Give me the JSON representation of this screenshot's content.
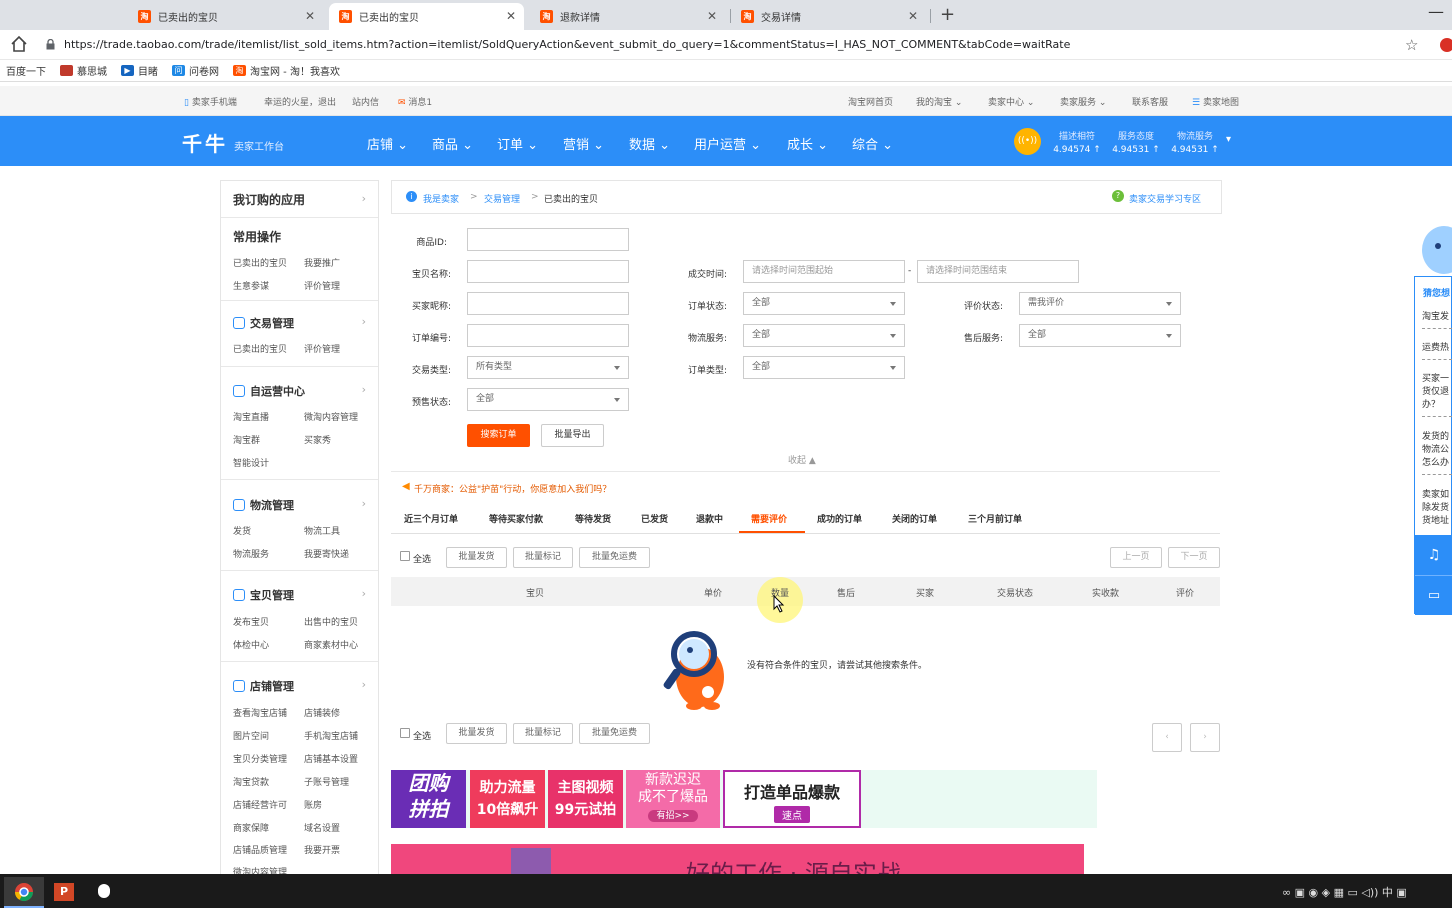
{
  "browser": {
    "tabs": [
      {
        "title": "已卖出的宝贝",
        "active": false
      },
      {
        "title": "已卖出的宝贝",
        "active": true
      },
      {
        "title": "退款详情",
        "active": false
      },
      {
        "title": "交易详情",
        "active": false
      }
    ],
    "favicon_text": "淘",
    "new_tab": "+",
    "minimize": "—",
    "url": "https://trade.taobao.com/trade/itemlist/list_sold_items.htm?action=itemlist/SoldQueryAction&event_submit_do_query=1&commentStatus=I_HAS_NOT_COMMENT&tabCode=waitRate",
    "bookmarks": [
      {
        "label": "百度一下",
        "color": ""
      },
      {
        "label": "慕思城",
        "color": "#c0392b"
      },
      {
        "label": "目睹",
        "color": "#1565c0"
      },
      {
        "label": "问卷网",
        "color": "#1e88e5"
      },
      {
        "label": "淘宝网 - 淘！我喜欢",
        "color": "#ff5000"
      }
    ]
  },
  "sitebar": {
    "mobile": "卖家手机端",
    "user": "幸运的火星，退出",
    "inbox": "站内信",
    "messages": "消息1",
    "home": "淘宝网首页",
    "my_taobao": "我的淘宝",
    "seller_center": "卖家中心",
    "seller_service": "卖家服务",
    "contact": "联系客服",
    "sitemap": "卖家地图"
  },
  "header": {
    "logo": "千牛",
    "logo_sub": "卖家工作台",
    "nav": [
      "店铺",
      "商品",
      "订单",
      "营销",
      "数据",
      "用户运营",
      "成长",
      "综合"
    ],
    "scores": [
      {
        "label": "描述相符",
        "value": "4.94574 ↑"
      },
      {
        "label": "服务态度",
        "value": "4.94531 ↑"
      },
      {
        "label": "物流服务",
        "value": "4.94531 ↑"
      }
    ]
  },
  "sidebar": {
    "my_apps": "我订购的应用",
    "common_title": "常用操作",
    "common": [
      "已卖出的宝贝",
      "我要推广",
      "生意参谋",
      "评价管理"
    ],
    "sections": [
      {
        "title": "交易管理",
        "links": [
          "已卖出的宝贝",
          "评价管理"
        ]
      },
      {
        "title": "自运营中心",
        "links": [
          "淘宝直播",
          "微淘内容管理",
          "淘宝群",
          "买家秀",
          "智能设计"
        ]
      },
      {
        "title": "物流管理",
        "links": [
          "发货",
          "物流工具",
          "物流服务",
          "我要寄快递"
        ]
      },
      {
        "title": "宝贝管理",
        "links": [
          "发布宝贝",
          "出售中的宝贝",
          "体检中心",
          "商家素材中心"
        ]
      },
      {
        "title": "店铺管理",
        "links": [
          "查看淘宝店铺",
          "店铺装修",
          "图片空间",
          "手机淘宝店铺",
          "宝贝分类管理",
          "店铺基本设置",
          "淘宝贷款",
          "子账号管理",
          "店铺经营许可",
          "账房",
          "商家保障",
          "域名设置",
          "店铺品质管理",
          "我要开票",
          "微淘内容管理"
        ]
      }
    ]
  },
  "breadcrumb": {
    "items": [
      "我是卖家",
      "交易管理",
      "已卖出的宝贝"
    ],
    "help": "卖家交易学习专区"
  },
  "filters": {
    "item_id": {
      "label": "商品ID:",
      "value": ""
    },
    "item_name": {
      "label": "宝贝名称:",
      "value": ""
    },
    "buyer": {
      "label": "买家昵称:",
      "value": ""
    },
    "order_no": {
      "label": "订单编号:",
      "value": ""
    },
    "trade_type": {
      "label": "交易类型:",
      "value": "所有类型"
    },
    "presale": {
      "label": "预售状态:",
      "value": "全部"
    },
    "deal_time": {
      "label": "成交时间:",
      "start": "请选择时间范围起始",
      "end": "请选择时间范围结束",
      "dash": "-"
    },
    "order_status": {
      "label": "订单状态:",
      "value": "全部"
    },
    "logistics": {
      "label": "物流服务:",
      "value": "全部"
    },
    "order_type": {
      "label": "订单类型:",
      "value": "全部"
    },
    "rate_status": {
      "label": "评价状态:",
      "value": "需我评价"
    },
    "after_sale": {
      "label": "售后服务:",
      "value": "全部"
    },
    "search_btn": "搜索订单",
    "export_btn": "批量导出",
    "collapse": "收起 ▲"
  },
  "notice": "千万商家：公益\"护苗\"行动，你愿意加入我们吗？",
  "order_tabs": [
    "近三个月订单",
    "等待买家付款",
    "等待发货",
    "已发货",
    "退款中",
    "需要评价",
    "成功的订单",
    "关闭的订单",
    "三个月前订单"
  ],
  "active_tab_index": 5,
  "bulk": {
    "select_all": "全选",
    "ship": "批量发货",
    "mark": "批量标记",
    "free_ship": "批量免运费",
    "prev": "上一页",
    "next": "下一页"
  },
  "table_headers": [
    "宝贝",
    "单价",
    "数量",
    "售后",
    "买家",
    "交易状态",
    "实收款",
    "评价"
  ],
  "empty_message": "没有符合条件的宝贝，请尝试其他搜索条件。",
  "banners": [
    {
      "line1": "团购",
      "line2": "拼拍",
      "bg": "#6a2db5"
    },
    {
      "line1": "助力流量",
      "line2": "10倍飙升",
      "bg": "#ef3b5c"
    },
    {
      "line1": "主图视频",
      "line2": "99元试拍",
      "bg": "#e8326a"
    },
    {
      "line1": "新款迟迟",
      "line2": "成不了爆品",
      "line3": "有招>>",
      "bg": "#f46ba8"
    },
    {
      "line1": "打造单品爆款",
      "line2": "速点",
      "bg": "#ffffff"
    }
  ],
  "banner2_text": "好的工作 · 源自实战",
  "right_panel": {
    "title": "猜您想",
    "items": [
      "淘宝发",
      "运费热",
      "买家一货仅退办？",
      "发货的物流公怎么办",
      "卖家如除发货货地址"
    ]
  },
  "colors": {
    "brand": "#2c8ef8",
    "accent": "#ff5000"
  }
}
